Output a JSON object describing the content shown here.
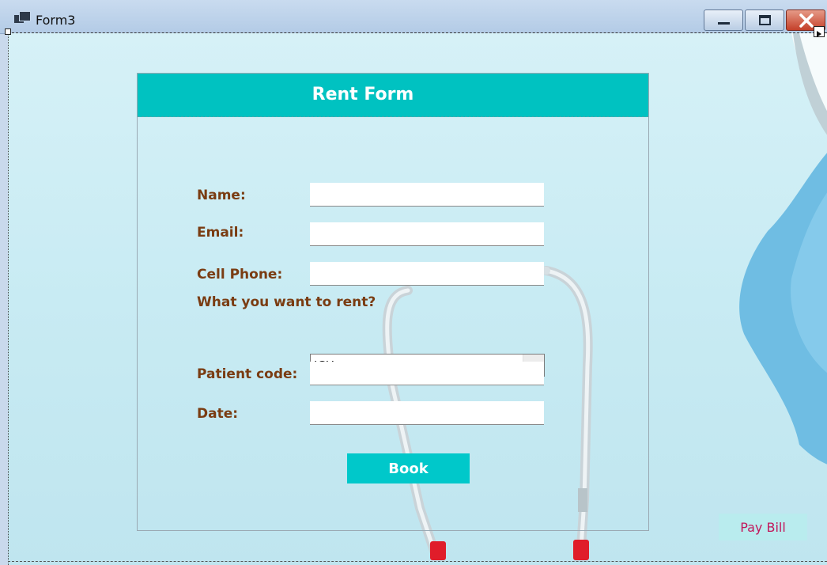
{
  "window": {
    "title": "Form3"
  },
  "form": {
    "title": "Rent Form",
    "fields": {
      "name": {
        "label": "Name:",
        "value": ""
      },
      "email": {
        "label": "Email:",
        "value": ""
      },
      "cell_phone": {
        "label": "Cell Phone:",
        "value": ""
      },
      "rent_item": {
        "label": "What you want to rent?",
        "selected": "ICU"
      },
      "patient_code": {
        "label": "Patient code:",
        "value": ""
      },
      "date": {
        "label": "Date:",
        "value": ""
      }
    },
    "book_label": "Book"
  },
  "pay_bill_label": "Pay Bill",
  "colors": {
    "header": "#00c2c1",
    "label": "#7a3c12",
    "book_button": "#00c8ca",
    "pay_bill_text": "#c2185b"
  }
}
